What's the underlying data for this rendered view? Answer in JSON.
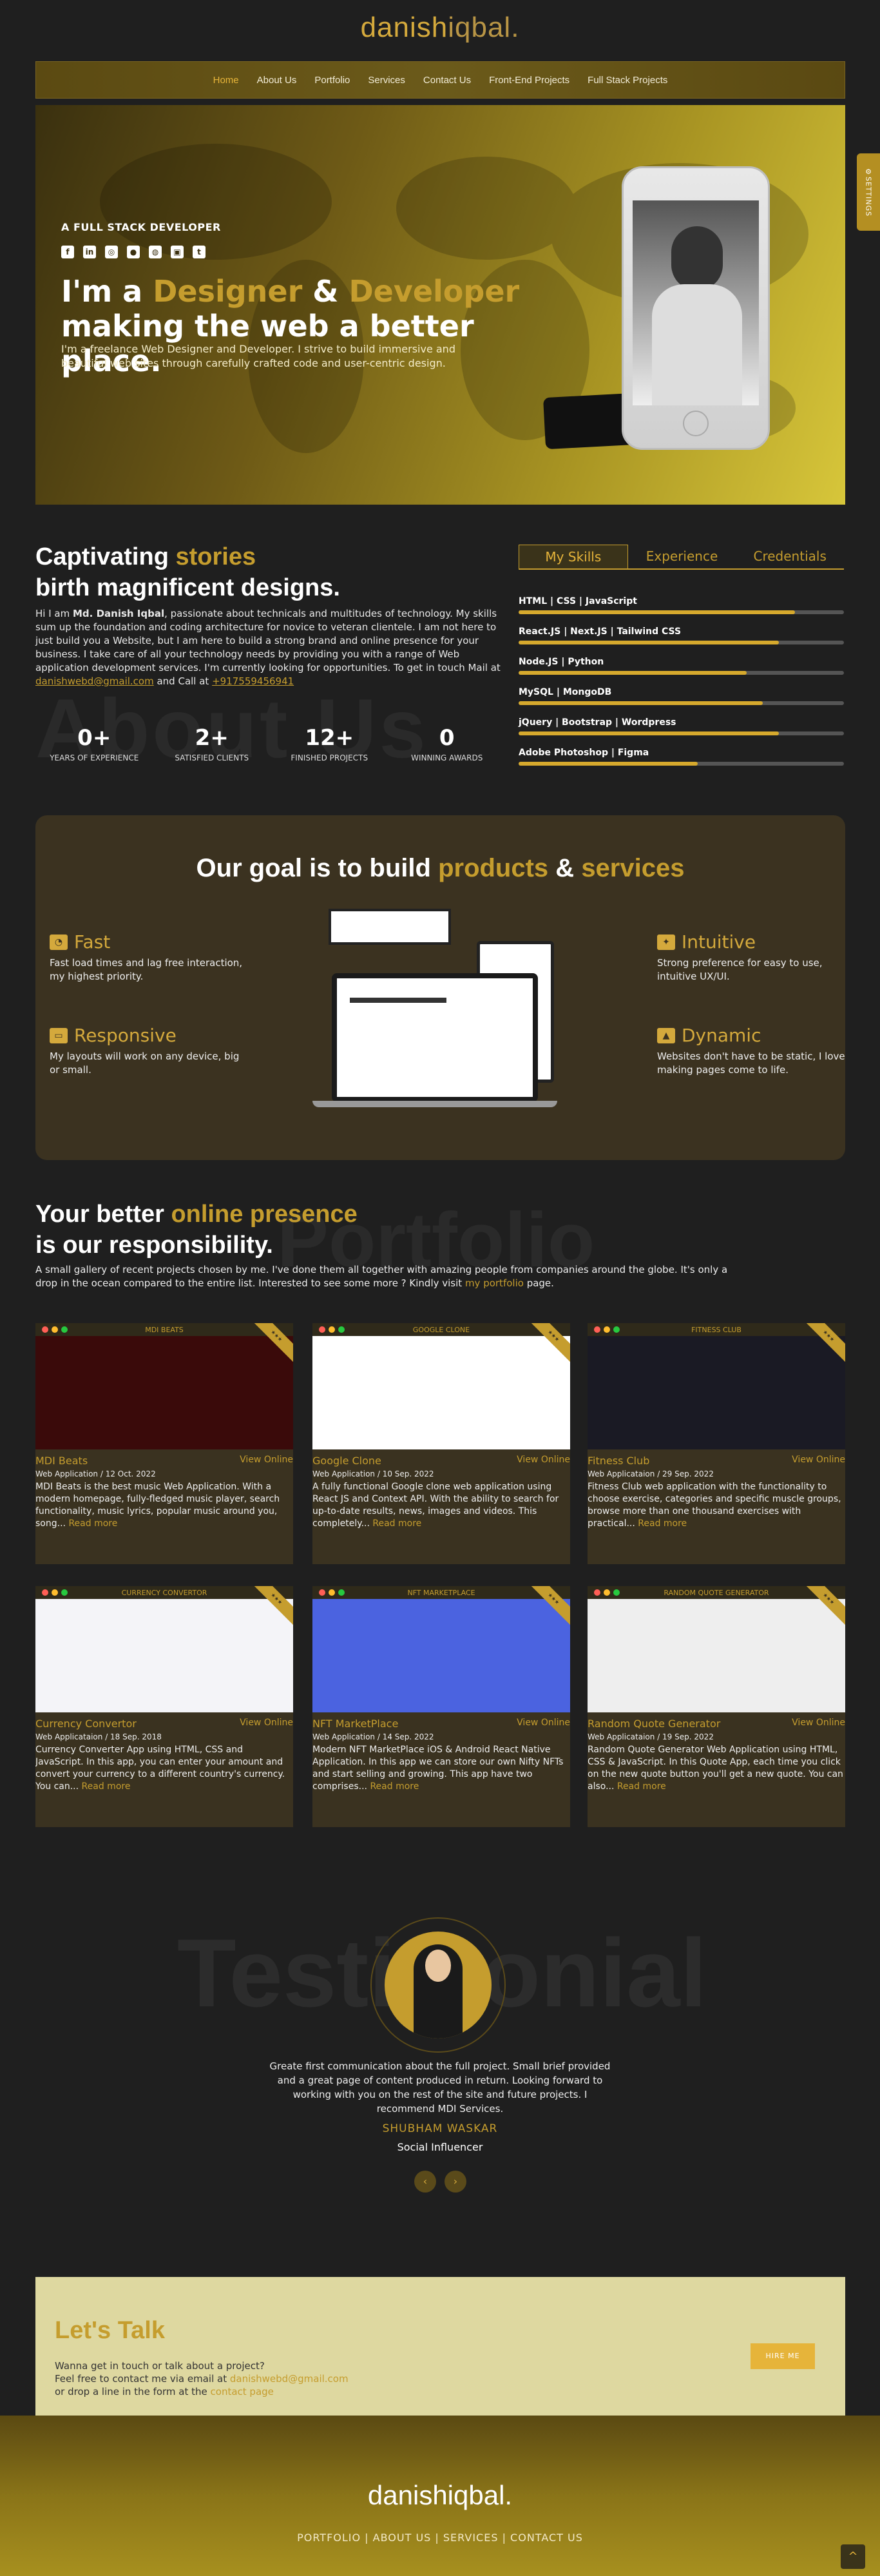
{
  "brand": {
    "logo_main": "danish",
    "logo_sub": "iqbal."
  },
  "nav": [
    "Home",
    "About Us",
    "Portfolio",
    "Services",
    "Contact Us",
    "Front-End Projects",
    "Full Stack Projects"
  ],
  "hero": {
    "subtitle": "A FULL STACK DEVELOPER",
    "title_1": "I'm a ",
    "title_designer": "Designer",
    "title_amp": " & ",
    "title_developer": "Developer",
    "title_2": "making the web a better place.",
    "desc": "I'm a freelance Web Designer and Developer. I strive to build immersive and beautiful web sites through carefully crafted code and user-centric design."
  },
  "settings_tab": "SETTINGS",
  "about": {
    "h_1": "Captivating ",
    "h_stories": "stories",
    "h_2": "birth magnificent designs.",
    "bg_word": "About Us",
    "p_1": "Hi I am ",
    "p_name": "Md. Danish Iqbal",
    "p_2": ", passionate about technicals and multitudes of technology. My skills sum up the foundation and coding architecture for novice to veteran clientele. I am not here to just build you a Website, but I am here to build a strong brand and online presence for your business. I take care of all your technology needs by providing you with a range of Web application development services. I'm currently looking for opportunities. To get in touch Mail at ",
    "p_email": "danishwebd@gmail.com",
    "p_3": " and Call at ",
    "p_phone": "+917559456941",
    "stats": [
      {
        "num": "0",
        "plus": "+",
        "label": "YEARS OF EXPERIENCE"
      },
      {
        "num": "2",
        "plus": "+",
        "label": "SATISFIED CLIENTS"
      },
      {
        "num": "12",
        "plus": "+",
        "label": "FINISHED PROJECTS"
      },
      {
        "num": "0",
        "plus": "",
        "label": "WINNING AWARDS"
      }
    ]
  },
  "skill_tabs": [
    "My Skills",
    "Experience",
    "Credentials"
  ],
  "skills": [
    {
      "name": "HTML | CSS | JavaScript",
      "pct": 0.85
    },
    {
      "name": "React.JS | Next.JS | Tailwind CSS",
      "pct": 0.8
    },
    {
      "name": "Node.JS | Python",
      "pct": 0.7
    },
    {
      "name": "MySQL | MongoDB",
      "pct": 0.75
    },
    {
      "name": "jQuery | Bootstrap | Wordpress",
      "pct": 0.8
    },
    {
      "name": "Adobe Photoshop | Figma",
      "pct": 0.55
    }
  ],
  "goal": {
    "t_1": "Our goal is to build ",
    "t_products": "products",
    "t_amp": " & ",
    "t_services": "services",
    "features": [
      {
        "title": "Fast",
        "desc": "Fast load times and lag free interaction, my highest priority."
      },
      {
        "title": "Responsive",
        "desc": "My layouts will work on any device, big or small."
      },
      {
        "title": "Intuitive",
        "desc": "Strong preference for easy to use, intuitive UX/UI."
      },
      {
        "title": "Dynamic",
        "desc": "Websites don't have to be static, I love making pages come to life."
      }
    ]
  },
  "portfolio": {
    "h_1": "Your better ",
    "h_online": "online presence",
    "h_2": "is our responsibility.",
    "bg_word": "Portfolio",
    "p": "A small gallery of recent projects chosen by me. I've done them all together with amazing people from companies around the globe. It's only a drop in the ocean compared to the entire list. Interested to see some more ? Kindly visit ",
    "p_link": "my portfolio",
    "p_end": " page.",
    "view": "View Online",
    "read_more": "Read more",
    "projects": [
      {
        "bar": "MDI BEATS",
        "name": "MDI Beats",
        "date": "Web Application / 12 Oct. 2022",
        "desc": "MDI Beats is the best music Web Application. With a modern homepage, fully-fledged music player, search functionality, music lyrics, popular music around you, song...",
        "shot": "#3a0a0a"
      },
      {
        "bar": "GOOGLE CLONE",
        "name": "Google Clone",
        "date": "Web Application / 10 Sep. 2022",
        "desc": "A fully functional Google clone web application using React JS and Context API. With the ability to search for up-to-date results, news, images and videos. This completely...",
        "shot": "#ffffff"
      },
      {
        "bar": "FITNESS CLUB",
        "name": "Fitness Club",
        "date": "Web Applicataion / 29 Sep. 2022",
        "desc": "Fitness Club web application with the functionality to choose exercise, categories and specific muscle groups, browse more than one thousand exercises with practical...",
        "shot": "#1a1a24"
      },
      {
        "bar": "CURRENCY CONVERTOR",
        "name": "Currency Convertor",
        "date": "Web Applicataion / 18 Sep. 2018",
        "desc": "Currency Converter App using HTML, CSS and JavaScript. In this app, you can enter your amount and convert your currency to a different country's currency. You can...",
        "shot": "#f4f4f8"
      },
      {
        "bar": "NFT MARKETPLACE",
        "name": "NFT MarketPlace",
        "date": "Web Application / 14 Sep. 2022",
        "desc": "Modern NFT MarketPlace iOS & Android React Native Application. In this app we can store our own Nifty NFTs and start selling and growing. This app have two comprises...",
        "shot": "#4b63e0"
      },
      {
        "bar": "RANDOM QUOTE GENERATOR",
        "name": "Random Quote Generator",
        "date": "Web Applicataion / 19 Sep. 2022",
        "desc": "Random Quote Generator Web Application using HTML, CSS & JavaScript. In this Quote App, each time you click on the new quote button you'll get a new quote. You can also...",
        "shot": "#eeeeee"
      }
    ]
  },
  "testimonial": {
    "bg_word": "Testimonial",
    "quote": "Greate first communication about the full project. Small brief provided and a great page of content produced in return. Looking forward to working with you on the rest of the site and future projects. I recommend MDI Services.",
    "name": "SHUBHAM WASKAR",
    "role": "Social Influencer",
    "prev": "‹",
    "next": "›"
  },
  "talk": {
    "h_1": "Let's ",
    "h_talk": "Talk",
    "l1": "Wanna get in touch or talk about a project?",
    "l2": "Feel free to contact me via email at ",
    "l2_email": "danishwebd@gmail.com",
    "l3": "or drop a line in the form at the ",
    "l3_link": "contact page",
    "hire": "HIRE ME"
  },
  "footer": {
    "logo_main": "danish",
    "logo_sub": "iqbal.",
    "links": "PORTFOLIO | ABOUT US | SERVICES | CONTACT US",
    "up": "^"
  }
}
